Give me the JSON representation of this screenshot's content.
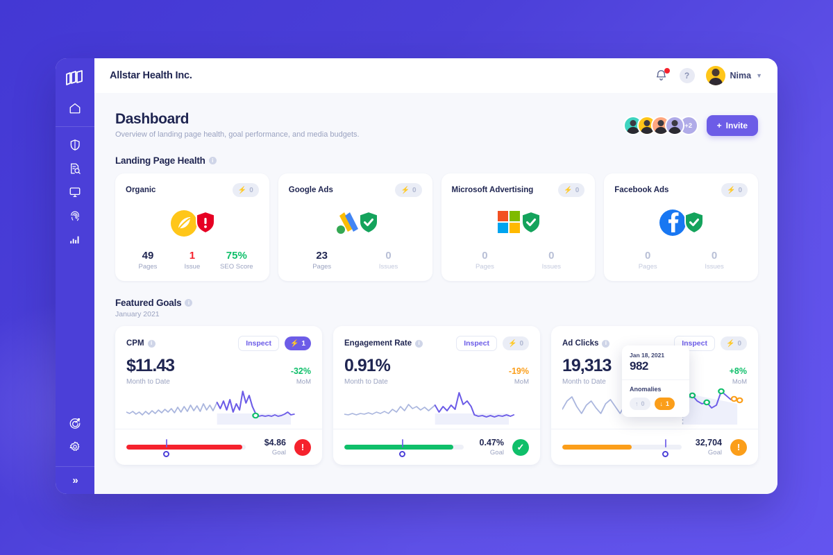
{
  "sidebar": {
    "logo_icon": "books-logo-icon",
    "items": [
      {
        "icon": "home-icon",
        "name": "home"
      },
      {
        "icon": "shield-icon",
        "name": "security"
      },
      {
        "icon": "document-search-icon",
        "name": "audit"
      },
      {
        "icon": "monitor-icon",
        "name": "monitor"
      },
      {
        "icon": "fingerprint-icon",
        "name": "identity"
      },
      {
        "icon": "bar-chart-icon",
        "name": "analytics"
      }
    ],
    "bottom_items": [
      {
        "icon": "target-icon",
        "name": "goals"
      },
      {
        "icon": "gear-icon",
        "name": "settings"
      }
    ],
    "collapse_label": "»"
  },
  "topbar": {
    "brand_title": "Allstar Health Inc.",
    "bell_icon": "bell-icon",
    "has_notification": true,
    "help_label": "?",
    "user_name": "Nima",
    "chevron_icon": "chevron-down-icon"
  },
  "page": {
    "title": "Dashboard",
    "subtitle": "Overview of landing page health, goal performance, and media budgets.",
    "avatar_overflow": "+2",
    "avatar_colors": [
      "#3fd4c0",
      "#ffc619",
      "#ffa77f",
      "#b0abe8"
    ],
    "invite_label": "Invite",
    "invite_icon": "plus-icon"
  },
  "landing_page_health": {
    "section_label": "Landing Page Health",
    "info_icon": "info-icon",
    "cards": [
      {
        "name": "Organic",
        "logo": "organic-leaf-logo",
        "shield": "alert",
        "badge": {
          "icon": "bolt-icon",
          "value": "0",
          "tone": "grey"
        },
        "stats": [
          {
            "value": "49",
            "label": "Pages",
            "tone": "dark"
          },
          {
            "value": "1",
            "label": "Issue",
            "tone": "red"
          },
          {
            "value": "75%",
            "label": "SEO Score",
            "tone": "green"
          }
        ]
      },
      {
        "name": "Google Ads",
        "logo": "google-ads-logo",
        "shield": "ok",
        "badge": {
          "icon": "bolt-icon",
          "value": "0",
          "tone": "grey"
        },
        "stats": [
          {
            "value": "23",
            "label": "Pages",
            "tone": "dark"
          },
          {
            "value": "0",
            "label": "Issues",
            "tone": "muted"
          }
        ]
      },
      {
        "name": "Microsoft Advertising",
        "logo": "microsoft-logo",
        "shield": "ok",
        "badge": {
          "icon": "bolt-icon",
          "value": "0",
          "tone": "grey"
        },
        "stats": [
          {
            "value": "0",
            "label": "Pages",
            "tone": "muted"
          },
          {
            "value": "0",
            "label": "Issues",
            "tone": "muted"
          }
        ]
      },
      {
        "name": "Facebook Ads",
        "logo": "facebook-logo",
        "shield": "ok",
        "badge": {
          "icon": "bolt-icon",
          "value": "0",
          "tone": "grey"
        },
        "stats": [
          {
            "value": "0",
            "label": "Pages",
            "tone": "muted"
          },
          {
            "value": "0",
            "label": "Issues",
            "tone": "muted"
          }
        ]
      }
    ]
  },
  "featured_goals": {
    "section_label": "Featured Goals",
    "info_icon": "info-icon",
    "date_label": "January 2021",
    "inspect_label": "Inspect",
    "cards": [
      {
        "name": "CPM",
        "badge": {
          "icon": "bolt-icon",
          "value": "1",
          "tone": "purple"
        },
        "metric": "$11.43",
        "metric_label": "Month to Date",
        "mom_value": "-32%",
        "mom_label": "MoM",
        "mom_tone": "green",
        "goal_value": "$4.86",
        "goal_label": "Goal",
        "bar_color": "#f5222d",
        "bar_fill_pct": 97,
        "marker_pct": 33,
        "status": "alert",
        "status_tone": "red"
      },
      {
        "name": "Engagement Rate",
        "badge": {
          "icon": "bolt-icon",
          "value": "0",
          "tone": "grey"
        },
        "metric": "0.91%",
        "metric_label": "Month to Date",
        "mom_value": "-19%",
        "mom_label": "MoM",
        "mom_tone": "orange",
        "goal_value": "0.47%",
        "goal_label": "Goal",
        "bar_color": "#0fbf6a",
        "bar_fill_pct": 91,
        "marker_pct": 48,
        "status": "check",
        "status_tone": "green"
      },
      {
        "name": "Ad Clicks",
        "badge": {
          "icon": "bolt-icon",
          "value": "0",
          "tone": "grey"
        },
        "metric": "19,313",
        "metric_label": "Month to Date",
        "mom_value": "+8%",
        "mom_label": "MoM",
        "mom_tone": "green",
        "goal_value": "32,704",
        "goal_label": "Goal",
        "bar_color": "#fb9e1a",
        "bar_fill_pct": 58,
        "marker_pct": 86,
        "status": "alert",
        "status_tone": "orange"
      }
    ],
    "tooltip": {
      "date": "Jan 18, 2021",
      "value": "982",
      "anomalies_label": "Anomalies",
      "up_icon": "arrow-up-icon",
      "up_value": "0",
      "down_icon": "arrow-down-icon",
      "down_value": "1"
    }
  },
  "chart_data": [
    {
      "type": "line",
      "title": "CPM sparkline",
      "ylabel": "",
      "xlabel": "",
      "values": [
        22,
        24,
        23,
        26,
        24,
        27,
        25,
        28,
        26,
        29,
        27,
        25,
        28,
        26,
        30,
        24,
        31,
        22,
        33,
        20,
        34,
        23,
        32,
        21,
        35,
        24,
        33,
        22,
        36,
        25,
        30,
        20,
        38,
        22,
        40,
        18,
        34,
        30,
        12,
        35,
        17,
        30,
        22,
        42,
        44,
        46,
        47,
        46,
        45,
        44,
        43,
        44,
        45,
        44,
        43,
        42,
        44,
        43
      ]
    },
    {
      "type": "line",
      "title": "Engagement Rate sparkline",
      "values": [
        24,
        25,
        24,
        26,
        25,
        27,
        25,
        26,
        27,
        26,
        28,
        26,
        29,
        27,
        30,
        26,
        31,
        25,
        33,
        24,
        34,
        26,
        32,
        22,
        36,
        24,
        30,
        18,
        38,
        26,
        34,
        22,
        40,
        28,
        12,
        34,
        20,
        32,
        26,
        44,
        45,
        46,
        47,
        46,
        45,
        46,
        45,
        44,
        45,
        46,
        45,
        44,
        45,
        46,
        45,
        44,
        45,
        44
      ]
    },
    {
      "type": "line",
      "title": "Ad Clicks sparkline",
      "values": [
        34,
        20,
        14,
        22,
        28,
        34,
        30,
        26,
        32,
        38,
        34,
        26,
        20,
        24,
        30,
        34,
        28,
        22,
        26,
        32,
        36,
        30,
        24,
        28,
        34,
        38,
        30,
        22,
        26,
        30,
        34,
        28,
        24,
        30,
        10,
        16,
        22,
        18,
        26,
        16,
        22,
        18,
        24,
        20,
        26
      ],
      "annotations": [
        {
          "label": "Jan 18, 2021",
          "value": 982,
          "anomalies_up": 0,
          "anomalies_down": 1
        }
      ]
    }
  ]
}
